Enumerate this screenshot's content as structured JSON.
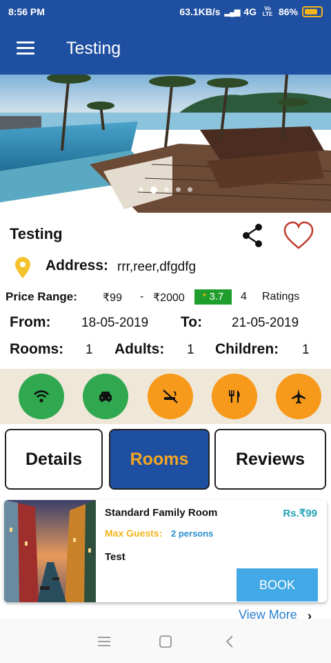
{
  "status_bar": {
    "time": "8:56 PM",
    "speed": "63.1KB/s",
    "network": "4G",
    "volte": "Vo LTE",
    "battery": "86%"
  },
  "app_bar": {
    "title": "Testing"
  },
  "hero": {
    "slide_count": 5,
    "active_slide": 2
  },
  "hotel": {
    "name": "Testing",
    "address_label": "Address:",
    "address_value": "rrr,reer,dfgdfg",
    "price_label": "Price Range:",
    "price_min": "₹99",
    "price_sep": "-",
    "price_max": "₹2000",
    "rating_star": "*",
    "rating": "3.7",
    "rating_count": "4",
    "ratings_word": "Ratings",
    "from_label": "From:",
    "from_value": "18-05-2019",
    "to_label": "To:",
    "to_value": "21-05-2019",
    "rooms_label": "Rooms:",
    "rooms_value": "1",
    "adults_label": "Adults:",
    "adults_value": "1",
    "children_label": "Children:",
    "children_value": "1"
  },
  "amenities": [
    {
      "icon": "wifi-icon",
      "color": "#2fa84f"
    },
    {
      "icon": "car-icon",
      "color": "#2fa84f"
    },
    {
      "icon": "no-smoking-icon",
      "color": "#f79a1b"
    },
    {
      "icon": "restaurant-icon",
      "color": "#f79a1b"
    },
    {
      "icon": "airplane-icon",
      "color": "#f79a1b"
    }
  ],
  "tabs": [
    {
      "label": "Details",
      "active": false
    },
    {
      "label": "Rooms",
      "active": true
    },
    {
      "label": "Reviews",
      "active": false
    }
  ],
  "room": {
    "title": "Standard Family Room",
    "price": "Rs.₹99",
    "guests_label": "Max Guests:",
    "guests_value": "2 persons",
    "description": "Test",
    "book_label": "BOOK"
  },
  "view_more": {
    "label": "View More",
    "chevron": "›"
  },
  "colors": {
    "primary": "#1f4fa0",
    "accent_orange": "#f5a623",
    "green": "#2fa84f",
    "book_blue": "#42a9e6",
    "rating_green": "#1e9e2c"
  }
}
